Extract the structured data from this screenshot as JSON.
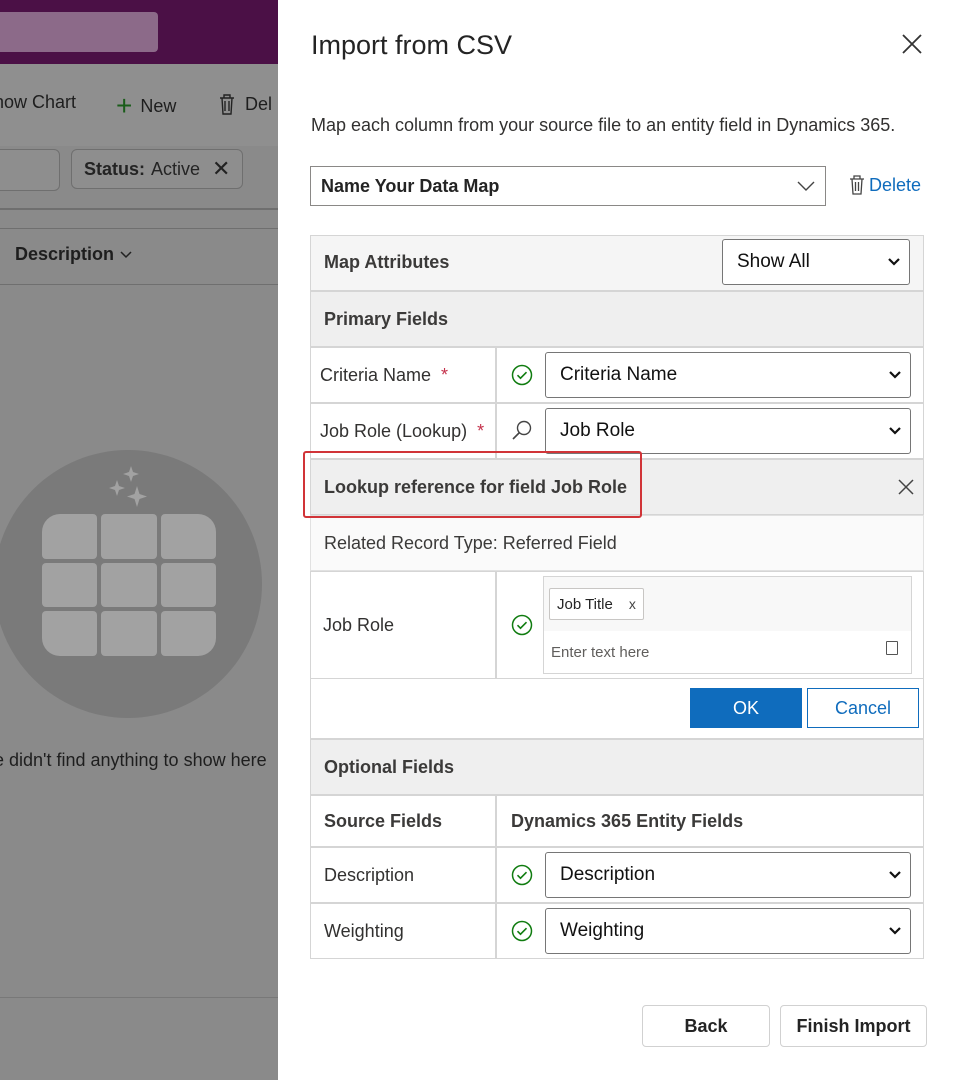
{
  "background": {
    "toolbar": {
      "show_chart": "how Chart",
      "new": "New",
      "delete": "Del"
    },
    "filter_chip": {
      "label": "Status:",
      "value": "Active"
    },
    "column_header": "Description",
    "empty_text": "e didn't find anything to show here",
    "colors": {
      "topbar": "#4b1046",
      "overlay": "#8a8a8a"
    }
  },
  "panel": {
    "title": "Import from CSV",
    "subtitle": "Map each column from your source file to an entity field in Dynamics 365.",
    "data_map": {
      "value": "Name Your Data Map"
    },
    "delete_label": "Delete",
    "map_attributes": {
      "label": "Map Attributes",
      "filter_value": "Show All"
    },
    "primary_section": "Primary Fields",
    "primary_rows": [
      {
        "source": "Criteria Name",
        "required": "*",
        "status_icon": "check-circle-icon",
        "target": "Criteria Name"
      },
      {
        "source": "Job Role (Lookup)",
        "required": "*",
        "status_icon": "search-icon",
        "target": "Job Role"
      }
    ],
    "lookup": {
      "title": "Lookup reference for field Job Role",
      "related_record": "Related Record Type: Referred Field",
      "field_label": "Job Role",
      "tag": "Job Title",
      "tag_remove": "x",
      "input_placeholder": "Enter text here",
      "ok_label": "OK",
      "cancel_label": "Cancel"
    },
    "optional_section": "Optional Fields",
    "optional_header": {
      "source": "Source Fields",
      "target": "Dynamics 365 Entity Fields"
    },
    "optional_rows": [
      {
        "source": "Description",
        "target": "Description"
      },
      {
        "source": "Weighting",
        "target": "Weighting"
      }
    ],
    "footer": {
      "back_label": "Back",
      "finish_label": "Finish Import"
    },
    "colors": {
      "accent": "#0f6cbd",
      "required": "#c4314b",
      "success": "#107c10",
      "highlight": "#d13438"
    }
  }
}
